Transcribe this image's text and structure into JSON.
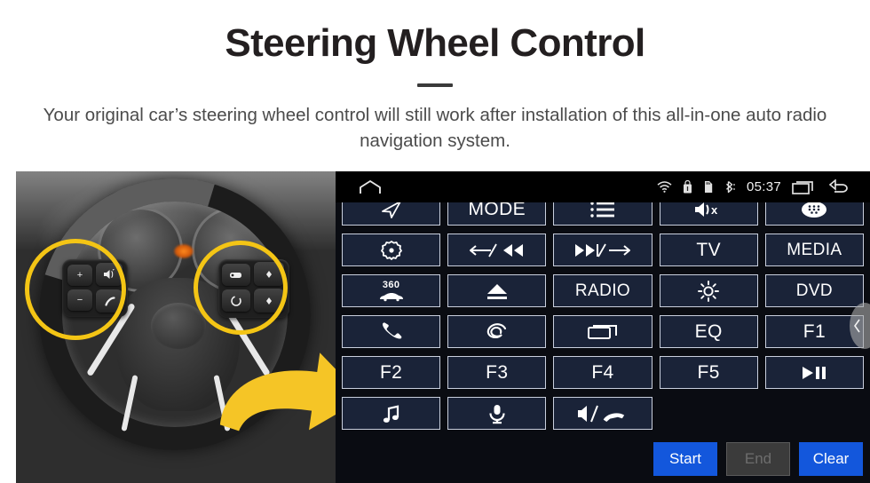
{
  "header": {
    "title": "Steering Wheel Control",
    "subtitle": "Your original car’s steering wheel control will still work after installation of this all-in-one auto radio navigation system."
  },
  "photo": {
    "alt": "steering-wheel-photo",
    "highlight_color": "#F4C515",
    "arrow_color": "#F5C526",
    "left_pad_keys": [
      "+",
      "−",
      "mute-icon",
      "phone-icon"
    ],
    "right_pad_keys": [
      "cruise-icon",
      "up-icon",
      "circle-icon",
      "down-icon"
    ]
  },
  "head_unit": {
    "background": "#0a0c12",
    "button_bg": "#1a2338",
    "button_border": "#c9cfdd",
    "status_bar": {
      "home_icon": "home-icon",
      "icons": [
        "wifi-icon",
        "usb-lock-icon",
        "sd-card-icon",
        "bluetooth-icon"
      ],
      "time": "05:37",
      "recents_icon": "recents-icon",
      "back_icon": "back-icon"
    },
    "buttons": [
      {
        "name": "navigation",
        "label": "",
        "icon": "navigation-arrow-icon"
      },
      {
        "name": "mode",
        "label": "MODE",
        "icon": ""
      },
      {
        "name": "list",
        "label": "",
        "icon": "list-icon"
      },
      {
        "name": "mute",
        "label": "",
        "icon": "mute-icon"
      },
      {
        "name": "apps",
        "label": "",
        "icon": "apps-icon"
      },
      {
        "name": "power",
        "label": "",
        "icon": "power-gear-icon"
      },
      {
        "name": "previous",
        "label": "",
        "icon": "prev-track-icon"
      },
      {
        "name": "next",
        "label": "",
        "icon": "next-track-icon"
      },
      {
        "name": "tv",
        "label": "TV",
        "icon": ""
      },
      {
        "name": "media",
        "label": "MEDIA",
        "icon": ""
      },
      {
        "name": "camera-360",
        "label": "360",
        "icon": "car-360-icon"
      },
      {
        "name": "eject",
        "label": "",
        "icon": "eject-icon"
      },
      {
        "name": "radio",
        "label": "RADIO",
        "icon": ""
      },
      {
        "name": "brightness",
        "label": "",
        "icon": "brightness-icon"
      },
      {
        "name": "dvd",
        "label": "DVD",
        "icon": ""
      },
      {
        "name": "call",
        "label": "",
        "icon": "phone-icon"
      },
      {
        "name": "navi-swirl",
        "label": "",
        "icon": "swirl-icon"
      },
      {
        "name": "screen",
        "label": "",
        "icon": "screen-icon"
      },
      {
        "name": "eq",
        "label": "EQ",
        "icon": ""
      },
      {
        "name": "f1",
        "label": "F1",
        "icon": ""
      },
      {
        "name": "f2",
        "label": "F2",
        "icon": ""
      },
      {
        "name": "f3",
        "label": "F3",
        "icon": ""
      },
      {
        "name": "f4",
        "label": "F4",
        "icon": ""
      },
      {
        "name": "f5",
        "label": "F5",
        "icon": ""
      },
      {
        "name": "play-pause",
        "label": "",
        "icon": "play-pause-icon"
      },
      {
        "name": "music",
        "label": "",
        "icon": "music-note-icon"
      },
      {
        "name": "voice",
        "label": "",
        "icon": "microphone-icon"
      },
      {
        "name": "volume-hangup",
        "label": "",
        "icon": "volume-hangup-icon"
      }
    ],
    "actions": [
      {
        "name": "start",
        "label": "Start",
        "state": "enabled",
        "color": "#1357DC"
      },
      {
        "name": "end",
        "label": "End",
        "state": "disabled",
        "color": "#3b3b3b"
      },
      {
        "name": "clear",
        "label": "Clear",
        "state": "enabled",
        "color": "#1357DC"
      }
    ],
    "side_handle": "collapse-panel-handle"
  }
}
